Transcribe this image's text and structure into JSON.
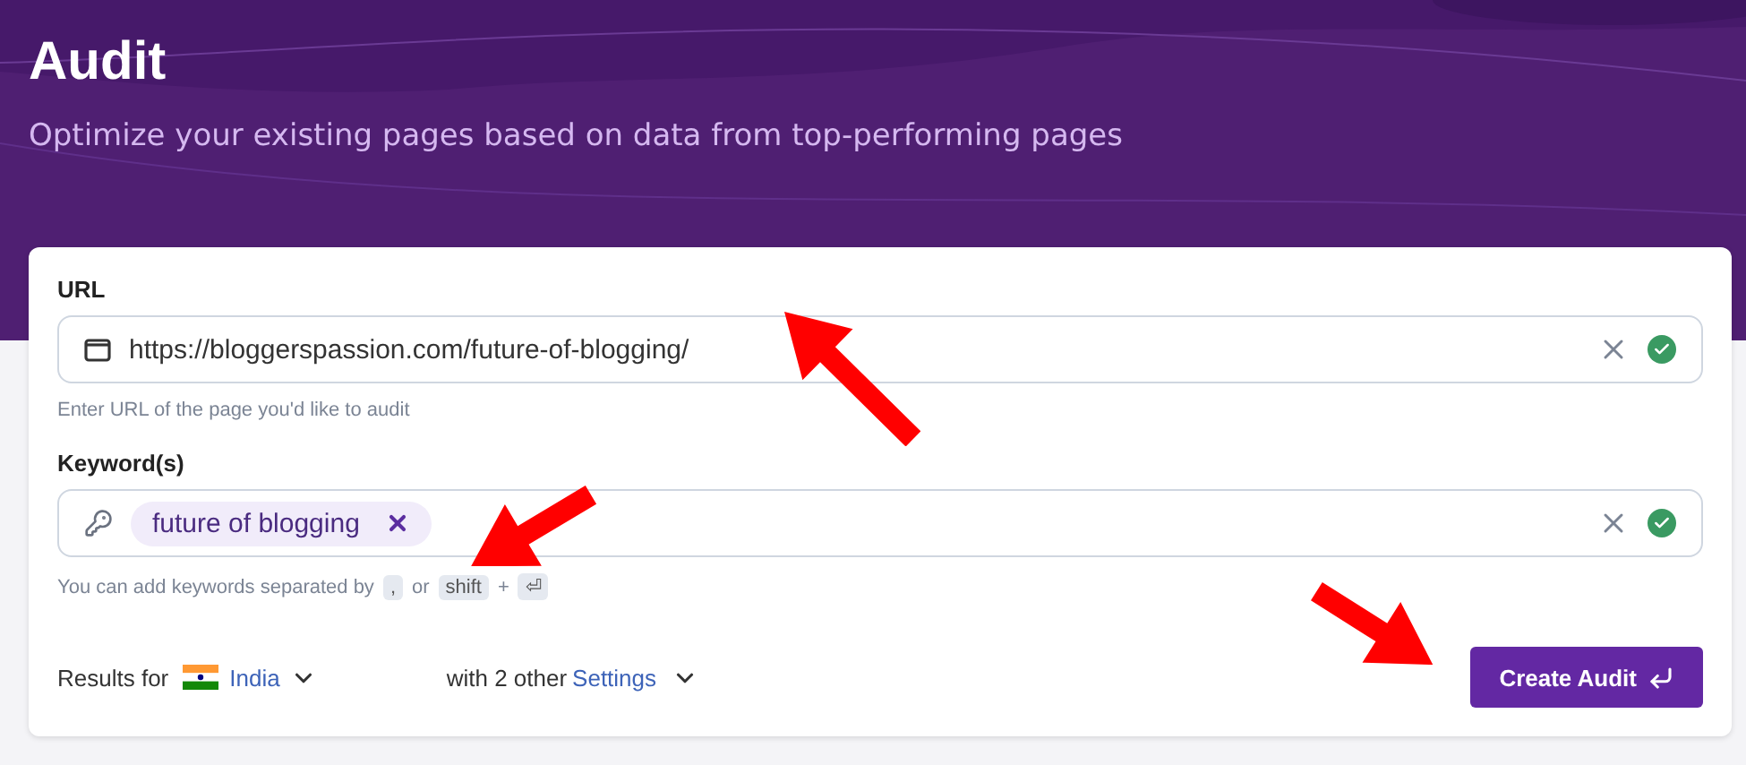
{
  "header": {
    "title": "Audit",
    "subtitle": "Optimize your existing pages based on data from top-performing pages"
  },
  "url_field": {
    "label": "URL",
    "value": "https://bloggerspassion.com/future-of-blogging/",
    "valid": true,
    "hint": "Enter URL of the page you'd like to audit"
  },
  "keyword_field": {
    "label": "Keyword(s)",
    "chips": [
      "future of blogging"
    ],
    "valid": true,
    "hint_parts": [
      {
        "kind": "text",
        "text": "You can add keywords separated by"
      },
      {
        "kind": "key",
        "text": ","
      },
      {
        "kind": "text",
        "text": "or"
      },
      {
        "kind": "key",
        "text": "shift"
      },
      {
        "kind": "text",
        "text": "+"
      },
      {
        "kind": "key",
        "text": "⏎"
      }
    ]
  },
  "results": {
    "label": "Results for",
    "country": "India",
    "settings_prefix": "with 2 other",
    "settings_link": "Settings"
  },
  "submit_button": "Create Audit"
}
